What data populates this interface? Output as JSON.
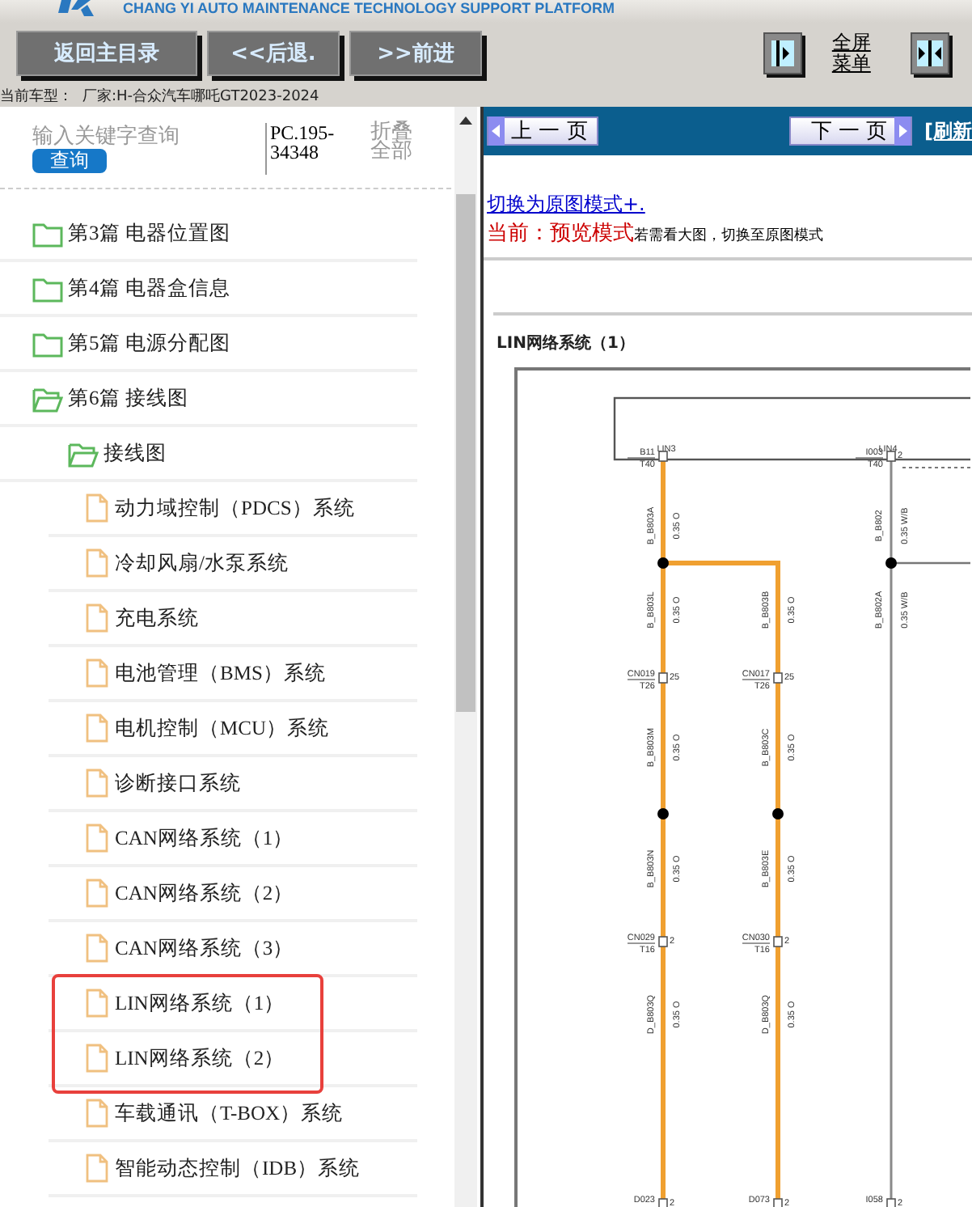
{
  "header": {
    "subtitle": "CHANG YI AUTO MAINTENANCE TECHNOLOGY SUPPORT PLATFORM"
  },
  "toolbar": {
    "buttons": [
      "返回主目录",
      "<<后退.",
      ">>前进"
    ],
    "fullscreen_link": "全屏菜单"
  },
  "vehicle": {
    "label": "当前车型：",
    "value": "厂家:H-合众汽车哪吒GT2023-2024"
  },
  "sidebar": {
    "search": {
      "placeholder": "输入关键字查询",
      "button": "查询"
    },
    "code": "PC.195-34348",
    "collapse_all": "折叠全部",
    "tree": [
      {
        "kind": "folder",
        "label": "第3篇 电器位置图",
        "expanded": false
      },
      {
        "kind": "folder",
        "label": "第4篇 电器盒信息",
        "expanded": false
      },
      {
        "kind": "folder",
        "label": "第5篇 电源分配图",
        "expanded": false
      },
      {
        "kind": "folder",
        "label": "第6篇 接线图",
        "expanded": true,
        "children": [
          {
            "kind": "folder",
            "label": "接线图",
            "expanded": true,
            "children": [
              {
                "kind": "file",
                "label": "动力域控制（PDCS）系统",
                "highlighted": false
              },
              {
                "kind": "file",
                "label": "冷却风扇/水泵系统",
                "highlighted": false
              },
              {
                "kind": "file",
                "label": "充电系统",
                "highlighted": false
              },
              {
                "kind": "file",
                "label": "电池管理（BMS）系统",
                "highlighted": false
              },
              {
                "kind": "file",
                "label": "电机控制（MCU）系统",
                "highlighted": false
              },
              {
                "kind": "file",
                "label": "诊断接口系统",
                "highlighted": false
              },
              {
                "kind": "file",
                "label": "CAN网络系统（1）",
                "highlighted": false
              },
              {
                "kind": "file",
                "label": "CAN网络系统（2）",
                "highlighted": false
              },
              {
                "kind": "file",
                "label": "CAN网络系统（3）",
                "highlighted": false
              },
              {
                "kind": "file",
                "label": "LIN网络系统（1）",
                "highlighted": true
              },
              {
                "kind": "file",
                "label": "LIN网络系统（2）",
                "highlighted": true
              },
              {
                "kind": "file",
                "label": "车载通讯（T-BOX）系统",
                "highlighted": false
              },
              {
                "kind": "file",
                "label": "智能动态控制（IDB）系统",
                "highlighted": false
              }
            ]
          }
        ]
      }
    ]
  },
  "viewer": {
    "prev": "上 一 页",
    "next": "下 一 页",
    "refresh": "[刷新",
    "mode_link": "切换为原图模式+.",
    "mode_label": "当前：预览模式",
    "mode_hint": "若需看大图，切换至原图模式",
    "diagram": {
      "title": "LIN网络系统（1）",
      "bus_labels": [
        "LIN3",
        "LIN4"
      ],
      "wires": [
        {
          "color": "#f0a030",
          "segments": [
            {
              "code": "B_B803A",
              "spec": "0.35 O"
            },
            {
              "code": "B_B803L",
              "spec": "0.35 O"
            },
            {
              "code": "B_B803M",
              "spec": "0.35 O"
            },
            {
              "code": "B_B803N",
              "spec": "0.35 O"
            },
            {
              "code": "D_B803Q",
              "spec": "0.35 O"
            }
          ],
          "connectors": [
            {
              "name": "B11",
              "part": "T40"
            },
            {
              "name": "CN019",
              "part": "T26",
              "pin": "25"
            },
            {
              "name": "CN029",
              "part": "T16",
              "pin": "2"
            },
            {
              "name": "D023",
              "pin": "2"
            }
          ]
        },
        {
          "color": "#f0a030",
          "segments": [
            {
              "code": "B_B803B",
              "spec": "0.35 O"
            },
            {
              "code": "B_B803C",
              "spec": "0.35 O"
            },
            {
              "code": "B_B803E",
              "spec": "0.35 O"
            },
            {
              "code": "D_B803Q",
              "spec": "0.35 O"
            }
          ],
          "connectors": [
            {
              "name": "CN017",
              "part": "T26",
              "pin": "25"
            },
            {
              "name": "CN030",
              "part": "T16",
              "pin": "2"
            },
            {
              "name": "D073",
              "pin": "2"
            }
          ]
        },
        {
          "color": "#8a8a8a",
          "segments": [
            {
              "code": "B_B802",
              "spec": "0.35 W/B"
            },
            {
              "code": "B_B802A",
              "spec": "0.35 W/B"
            }
          ],
          "connectors": [
            {
              "name": "I003",
              "part": "T40",
              "pin": "2"
            },
            {
              "name": "I058",
              "pin": "2"
            }
          ]
        }
      ]
    }
  }
}
